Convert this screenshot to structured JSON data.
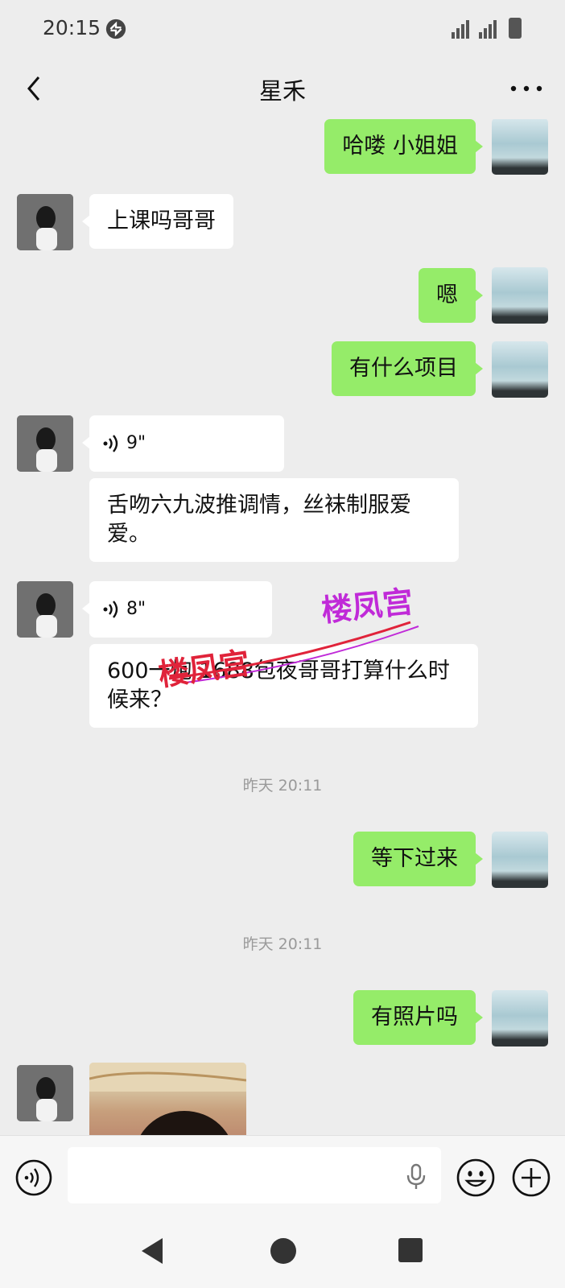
{
  "status_bar": {
    "time": "20:15"
  },
  "header": {
    "title": "星禾"
  },
  "messages": [
    {
      "side": "me",
      "text": "哈喽 小姐姐"
    },
    {
      "side": "her",
      "text": "上课吗哥哥"
    },
    {
      "side": "me",
      "text": "嗯"
    },
    {
      "side": "me",
      "text": "有什么项目"
    },
    {
      "side": "her",
      "voice": "9\""
    },
    {
      "side": "her",
      "text": "舌吻六九波推调情，丝袜制服爱爱。"
    },
    {
      "side": "her",
      "voice": "8\""
    },
    {
      "side": "her",
      "text": "600一炮 1688包夜哥哥打算什么时候来？"
    },
    {
      "timestamp": "昨天 20:11"
    },
    {
      "side": "me",
      "text": "等下过来"
    },
    {
      "timestamp": "昨天 20:11"
    },
    {
      "side": "me",
      "text": "有照片吗"
    },
    {
      "side": "her",
      "image": "photo"
    }
  ],
  "watermark": {
    "text": "楼凤宫"
  },
  "colors": {
    "background": "#ededed",
    "my_bubble": "#95ec69",
    "her_bubble": "#ffffff",
    "watermark_red": "#e0233a",
    "watermark_purple": "#c02ad8"
  },
  "icons": [
    "sync-icon",
    "signal-icon",
    "battery-icon",
    "back-icon",
    "more-icon",
    "voice-wave-icon",
    "voice-input-icon",
    "mic-icon",
    "emoji-icon",
    "add-icon",
    "nav-back-icon",
    "nav-home-icon",
    "nav-recents-icon"
  ]
}
